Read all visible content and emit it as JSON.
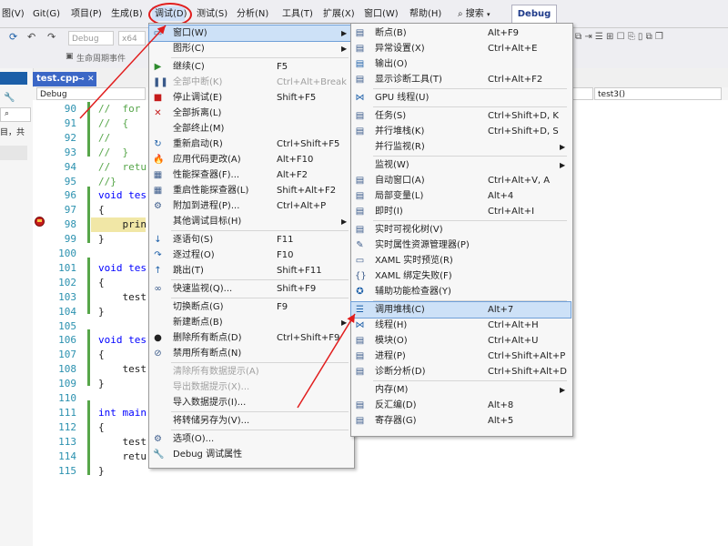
{
  "menubar": {
    "items": [
      "图(V)",
      "Git(G)",
      "项目(P)",
      "生成(B)",
      "调试(D)",
      "测试(S)",
      "分析(N)",
      "工具(T)",
      "扩展(X)",
      "窗口(W)",
      "帮助(H)"
    ],
    "search": "搜索",
    "config": "Debug"
  },
  "toolbar": {
    "config": "Debug",
    "platform": "x64",
    "lifecycle": "生命周期事件",
    "sub_config": "Debug",
    "func_combo": "test3()"
  },
  "left": {
    "text": "目，共"
  },
  "tab": {
    "label": "test.cpp"
  },
  "editor": {
    "lines": [
      {
        "n": "90",
        "code": "//  for"
      },
      {
        "n": "91",
        "code": "//  {"
      },
      {
        "n": "92",
        "code": "//"
      },
      {
        "n": "93",
        "code": "//  }"
      },
      {
        "n": "94",
        "code": "//  retu"
      },
      {
        "n": "95",
        "code": "//}"
      },
      {
        "n": "96",
        "code": "void tes"
      },
      {
        "n": "97",
        "code": "{"
      },
      {
        "n": "98",
        "code": "    prin"
      },
      {
        "n": "99",
        "code": "}"
      },
      {
        "n": "100",
        "code": ""
      },
      {
        "n": "101",
        "code": "void tes"
      },
      {
        "n": "102",
        "code": "{"
      },
      {
        "n": "103",
        "code": "    test"
      },
      {
        "n": "104",
        "code": "}"
      },
      {
        "n": "105",
        "code": ""
      },
      {
        "n": "106",
        "code": "void tes"
      },
      {
        "n": "107",
        "code": "{"
      },
      {
        "n": "108",
        "code": "    test"
      },
      {
        "n": "109",
        "code": "}"
      },
      {
        "n": "110",
        "code": ""
      },
      {
        "n": "111",
        "code": "int main"
      },
      {
        "n": "112",
        "code": "{"
      },
      {
        "n": "113",
        "code": "    test"
      },
      {
        "n": "114",
        "code": "    retu"
      },
      {
        "n": "115",
        "code": "}"
      }
    ]
  },
  "debug_menu": {
    "items": [
      {
        "label": "窗口(W)",
        "shortcut": "",
        "arrow": true,
        "icon": "window-icon",
        "disabled": false,
        "highlight": true
      },
      {
        "label": "图形(C)",
        "shortcut": "",
        "arrow": true,
        "icon": "",
        "disabled": false
      },
      {
        "sep": true
      },
      {
        "label": "继续(C)",
        "shortcut": "F5",
        "icon": "play-icon",
        "disabled": false
      },
      {
        "label": "全部中断(K)",
        "shortcut": "Ctrl+Alt+Break",
        "icon": "pause-icon",
        "disabled": true
      },
      {
        "label": "停止调试(E)",
        "shortcut": "Shift+F5",
        "icon": "stop-icon",
        "disabled": false
      },
      {
        "label": "全部拆离(L)",
        "shortcut": "",
        "icon": "detach-icon",
        "disabled": false
      },
      {
        "label": "全部终止(M)",
        "shortcut": "",
        "icon": "",
        "disabled": false
      },
      {
        "label": "重新启动(R)",
        "shortcut": "Ctrl+Shift+F5",
        "icon": "restart-icon",
        "disabled": false
      },
      {
        "label": "应用代码更改(A)",
        "shortcut": "Alt+F10",
        "icon": "hot-reload-icon",
        "disabled": false
      },
      {
        "label": "性能探查器(F)...",
        "shortcut": "Alt+F2",
        "icon": "profiler-icon",
        "disabled": false
      },
      {
        "label": "重启性能探查器(L)",
        "shortcut": "Shift+Alt+F2",
        "icon": "profiler-restart-icon",
        "disabled": false
      },
      {
        "label": "附加到进程(P)...",
        "shortcut": "Ctrl+Alt+P",
        "icon": "attach-icon",
        "disabled": false
      },
      {
        "label": "其他调试目标(H)",
        "shortcut": "",
        "arrow": true,
        "icon": "",
        "disabled": false
      },
      {
        "sep": true
      },
      {
        "label": "逐语句(S)",
        "shortcut": "F11",
        "icon": "step-into-icon",
        "disabled": false
      },
      {
        "label": "逐过程(O)",
        "shortcut": "F10",
        "icon": "step-over-icon",
        "disabled": false
      },
      {
        "label": "跳出(T)",
        "shortcut": "Shift+F11",
        "icon": "step-out-icon",
        "disabled": false
      },
      {
        "sep": true
      },
      {
        "label": "快速监视(Q)...",
        "shortcut": "Shift+F9",
        "icon": "glasses-icon",
        "disabled": false
      },
      {
        "sep": true
      },
      {
        "label": "切换断点(G)",
        "shortcut": "F9",
        "icon": "",
        "disabled": false
      },
      {
        "label": "新建断点(B)",
        "shortcut": "",
        "arrow": true,
        "icon": "",
        "disabled": false
      },
      {
        "label": "删除所有断点(D)",
        "shortcut": "Ctrl+Shift+F9",
        "icon": "delete-breakpoints-icon",
        "disabled": false
      },
      {
        "label": "禁用所有断点(N)",
        "shortcut": "",
        "icon": "disable-breakpoints-icon",
        "disabled": false
      },
      {
        "sep": true
      },
      {
        "label": "清除所有数据提示(A)",
        "shortcut": "",
        "icon": "",
        "disabled": true
      },
      {
        "label": "导出数据提示(X)...",
        "shortcut": "",
        "icon": "",
        "disabled": true
      },
      {
        "label": "导入数据提示(I)...",
        "shortcut": "",
        "icon": "",
        "disabled": false
      },
      {
        "sep": true
      },
      {
        "label": "将转储另存为(V)...",
        "shortcut": "",
        "icon": "",
        "disabled": false
      },
      {
        "sep": true
      },
      {
        "label": "选项(O)...",
        "shortcut": "",
        "icon": "gear-icon",
        "disabled": false
      },
      {
        "label": "Debug 调试属性",
        "shortcut": "",
        "icon": "wrench-icon",
        "disabled": false
      }
    ]
  },
  "window_menu": {
    "items": [
      {
        "label": "断点(B)",
        "shortcut": "Alt+F9",
        "icon": "breakpoints-window-icon"
      },
      {
        "label": "异常设置(X)",
        "shortcut": "Ctrl+Alt+E",
        "icon": "exception-icon"
      },
      {
        "label": "输出(O)",
        "shortcut": "",
        "icon": "output-icon"
      },
      {
        "label": "显示诊断工具(T)",
        "shortcut": "Ctrl+Alt+F2",
        "icon": "diagnostics-icon"
      },
      {
        "sep": true
      },
      {
        "label": "GPU 线程(U)",
        "shortcut": "",
        "icon": "gpu-threads-icon"
      },
      {
        "sep": true
      },
      {
        "label": "任务(S)",
        "shortcut": "Ctrl+Shift+D, K",
        "icon": "tasks-icon"
      },
      {
        "label": "并行堆栈(K)",
        "shortcut": "Ctrl+Shift+D, S",
        "icon": "parallel-stacks-icon"
      },
      {
        "label": "并行监视(R)",
        "shortcut": "",
        "arrow": true,
        "icon": ""
      },
      {
        "sep": true
      },
      {
        "label": "监视(W)",
        "shortcut": "",
        "arrow": true,
        "icon": ""
      },
      {
        "label": "自动窗口(A)",
        "shortcut": "Ctrl+Alt+V, A",
        "icon": "autos-icon"
      },
      {
        "label": "局部变量(L)",
        "shortcut": "Alt+4",
        "icon": "locals-icon"
      },
      {
        "label": "即时(I)",
        "shortcut": "Ctrl+Alt+I",
        "icon": "immediate-icon"
      },
      {
        "sep": true
      },
      {
        "label": "实时可视化树(V)",
        "shortcut": "",
        "icon": "visual-tree-icon"
      },
      {
        "label": "实时属性资源管理器(P)",
        "shortcut": "",
        "icon": "property-explorer-icon"
      },
      {
        "label": "XAML 实时预览(R)",
        "shortcut": "",
        "icon": "xaml-preview-icon"
      },
      {
        "label": "XAML 绑定失败(F)",
        "shortcut": "",
        "icon": "xaml-binding-icon"
      },
      {
        "label": "辅助功能检查器(Y)",
        "shortcut": "",
        "icon": "accessibility-icon"
      },
      {
        "sep": true
      },
      {
        "label": "调用堆栈(C)",
        "shortcut": "Alt+7",
        "icon": "call-stack-icon",
        "highlight": true
      },
      {
        "label": "线程(H)",
        "shortcut": "Ctrl+Alt+H",
        "icon": "threads-icon"
      },
      {
        "label": "模块(O)",
        "shortcut": "Ctrl+Alt+U",
        "icon": "modules-icon"
      },
      {
        "label": "进程(P)",
        "shortcut": "Ctrl+Shift+Alt+P",
        "icon": "processes-icon"
      },
      {
        "label": "诊断分析(D)",
        "shortcut": "Ctrl+Shift+Alt+D",
        "icon": "diagnostic-analysis-icon"
      },
      {
        "sep": true
      },
      {
        "label": "内存(M)",
        "shortcut": "",
        "arrow": true,
        "icon": ""
      },
      {
        "label": "反汇编(D)",
        "shortcut": "Alt+8",
        "icon": "disassembly-icon"
      },
      {
        "label": "寄存器(G)",
        "shortcut": "Alt+5",
        "icon": "registers-icon"
      }
    ]
  },
  "colors": {
    "annotation": "#e11d1d",
    "highlight": "#cde1f7",
    "accent": "#1c5fa8"
  }
}
